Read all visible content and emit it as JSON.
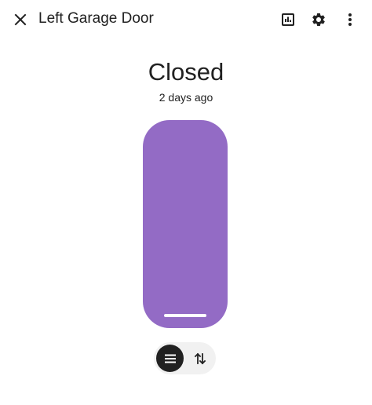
{
  "header": {
    "title": "Left Garage Door",
    "close_icon": "close-icon",
    "history_icon": "history-chart-icon",
    "settings_icon": "gear-icon",
    "more_icon": "more-vertical-icon"
  },
  "entity": {
    "state": "Closed",
    "last_changed": "2 days ago"
  },
  "control": {
    "door_color": "#936bc5",
    "handle_color": "#ffffff"
  },
  "mode_toggle": {
    "active_mode": "hamburger-lines-icon",
    "inactive_mode": "up-down-arrows-icon",
    "active_background": "#212121",
    "toggle_background": "#f1f1f1"
  }
}
